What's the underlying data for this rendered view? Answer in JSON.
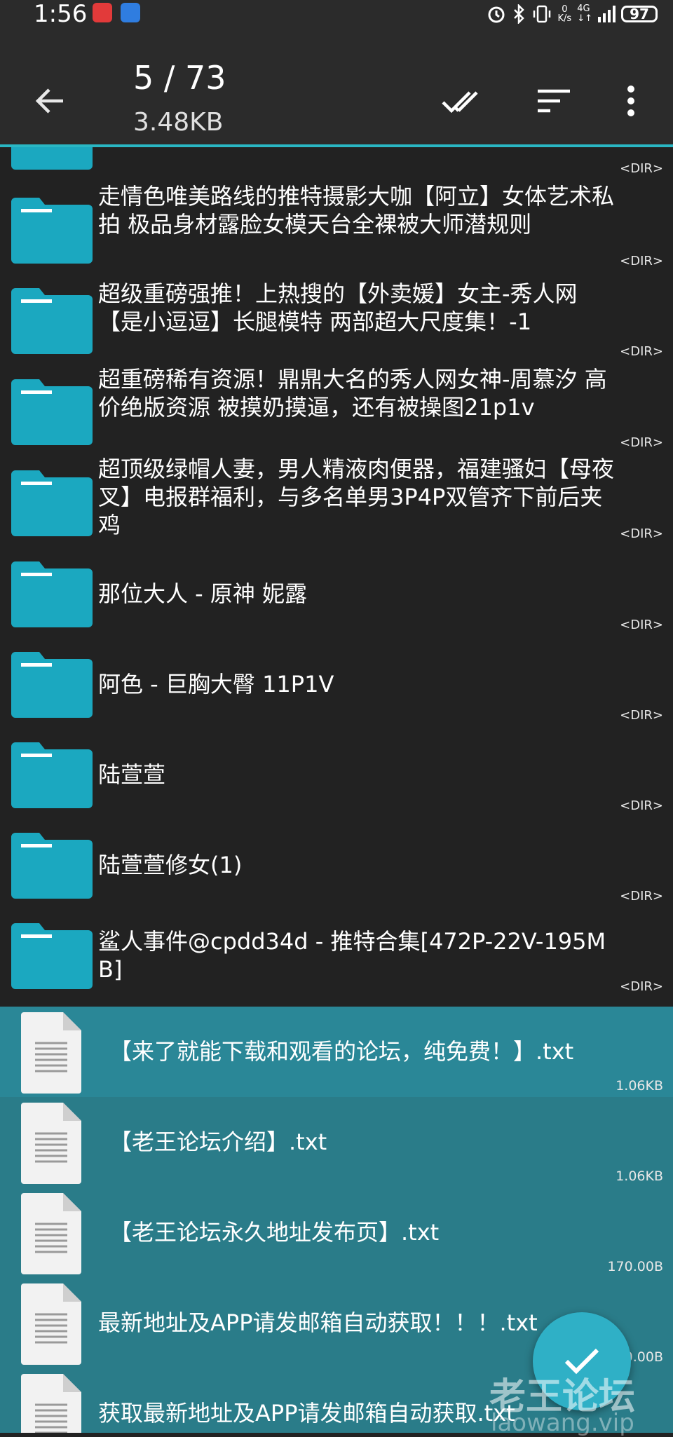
{
  "status_bar": {
    "time": "1:56",
    "net_speed_value": "0",
    "net_speed_unit": "K/s",
    "network": "4G",
    "battery": "97"
  },
  "toolbar": {
    "position": "5 / 73",
    "total_size": "3.48KB",
    "icons": [
      "back-arrow",
      "select-all-check",
      "sort",
      "more-vert"
    ]
  },
  "colors": {
    "background": "#222222",
    "toolbar": "#2b2b2b",
    "accent": "#2ab7c4",
    "folder": "#1ba8c0",
    "selected_row": "#2a7c89",
    "fab": "#2fb0c6"
  },
  "items": [
    {
      "type": "folder",
      "name": "",
      "meta": "<DIR>"
    },
    {
      "type": "folder",
      "name": "走情色唯美路线的推特摄影大咖【阿立】女体艺术私拍 极品身材露脸女模天台全裸被大师潜规则",
      "meta": "<DIR>"
    },
    {
      "type": "folder",
      "name": "超级重磅强推！上热搜的【外卖媛】女主-秀人网【是小逗逗】长腿模特 两部超大尺度集！-1",
      "meta": "<DIR>"
    },
    {
      "type": "folder",
      "name": "超重磅稀有资源！鼎鼎大名的秀人网女神-周慕汐 高价绝版资源 被摸奶摸逼，还有被操图21p1v",
      "meta": "<DIR>"
    },
    {
      "type": "folder",
      "name": "超顶级绿帽人妻，男人精液肉便器，福建骚妇【母夜叉】电报群福利，与多名单男3P4P双管齐下前后夹鸡",
      "meta": "<DIR>"
    },
    {
      "type": "folder",
      "name": "那位大人 - 原神 妮露",
      "meta": "<DIR>"
    },
    {
      "type": "folder",
      "name": "阿色 - 巨胸大臀 11P1V",
      "meta": "<DIR>"
    },
    {
      "type": "folder",
      "name": "陆萱萱",
      "meta": "<DIR>"
    },
    {
      "type": "folder",
      "name": "陆萱萱修女(1)",
      "meta": "<DIR>"
    },
    {
      "type": "folder",
      "name": "鲨人事件@cpdd34d - 推特合集[472P-22V-195MB]",
      "meta": "<DIR>"
    },
    {
      "type": "file",
      "name": "【来了就能下载和观看的论坛，纯免费！】.txt",
      "meta": "1.06KB"
    },
    {
      "type": "file",
      "name": "【老王论坛介绍】.txt",
      "meta": "1.06KB"
    },
    {
      "type": "file",
      "name": "【老王论坛永久地址发布页】.txt",
      "meta": "170.00B"
    },
    {
      "type": "file",
      "name": "最新地址及APP请发邮箱自动获取！！！.txt",
      "meta": "170.00B"
    },
    {
      "type": "file",
      "name": "获取最新地址及APP请发邮箱自动获取.txt",
      "meta": ""
    }
  ],
  "watermark": {
    "text": "老王论坛",
    "url": "laowang.vip"
  }
}
